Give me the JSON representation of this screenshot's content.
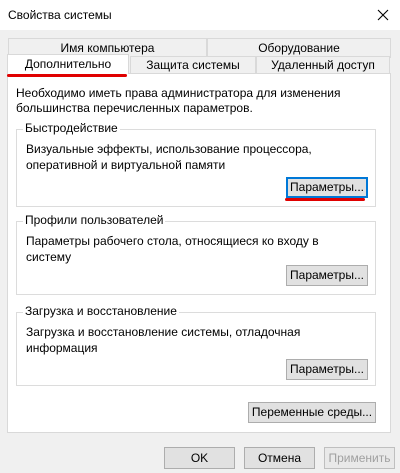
{
  "window": {
    "title": "Свойства системы",
    "close_icon": "close-icon"
  },
  "tabs_row1": [
    {
      "label": "Имя компьютера"
    },
    {
      "label": "Оборудование"
    }
  ],
  "tabs_row2": [
    {
      "label": "Дополнительно",
      "selected": true
    },
    {
      "label": "Защита системы"
    },
    {
      "label": "Удаленный доступ"
    }
  ],
  "intro_text": "Необходимо иметь права администратора для изменения большинства перечисленных параметров.",
  "groups": [
    {
      "title": "Быстродействие",
      "description": "Визуальные эффекты, использование процессора, оперативной и виртуальной памяти",
      "button_label": "Параметры..."
    },
    {
      "title": "Профили пользователей",
      "description": "Параметры рабочего стола, относящиеся ко входу в систему",
      "button_label": "Параметры..."
    },
    {
      "title": "Загрузка и восстановление",
      "description": "Загрузка и восстановление системы, отладочная информация",
      "button_label": "Параметры..."
    }
  ],
  "env_button_label": "Переменные среды...",
  "footer": {
    "ok_label": "OK",
    "cancel_label": "Отмена",
    "apply_label": "Применить"
  },
  "colors": {
    "highlight_underline": "#e00000",
    "focus_border": "#0078d7"
  }
}
